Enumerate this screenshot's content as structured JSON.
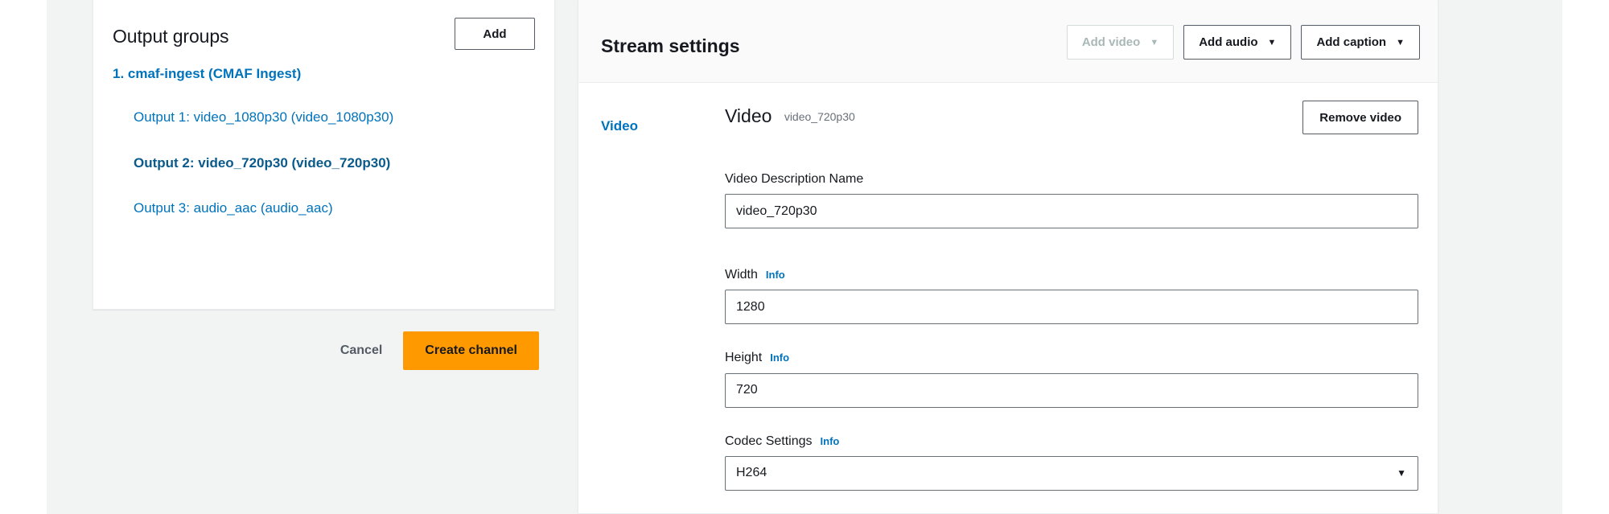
{
  "colors": {
    "link": "#0073bb",
    "primary_button": "#ff9900",
    "page_background": "#f2f3f3",
    "panel_header_background": "#fafafa",
    "border": "#eaeded",
    "input_border": "#687078",
    "muted_text": "#687078",
    "disabled_text": "#aab7b8"
  },
  "output_groups_panel": {
    "title": "Output groups",
    "add_button_label": "Add",
    "groups": [
      {
        "label": "1. cmaf-ingest (CMAF Ingest)",
        "outputs": [
          {
            "label": "Output 1: video_1080p30 (video_1080p30)",
            "selected": false
          },
          {
            "label": "Output 2: video_720p30 (video_720p30)",
            "selected": true
          },
          {
            "label": "Output 3: audio_aac (audio_aac)",
            "selected": false
          }
        ]
      }
    ]
  },
  "form_actions": {
    "cancel_label": "Cancel",
    "submit_label": "Create channel"
  },
  "stream_settings_panel": {
    "title": "Stream settings",
    "actions": [
      {
        "label": "Add video",
        "caret": "▼",
        "disabled": true
      },
      {
        "label": "Add audio",
        "caret": "▼",
        "disabled": false
      },
      {
        "label": "Add caption",
        "caret": "▼",
        "disabled": false
      }
    ],
    "nav": [
      {
        "label": "Video",
        "selected": true
      }
    ],
    "section": {
      "title": "Video",
      "subtitle": "video_720p30",
      "remove_button_label": "Remove video"
    },
    "fields": {
      "video_description_name": {
        "label": "Video Description Name",
        "value": "video_720p30",
        "placeholder": ""
      },
      "width": {
        "label": "Width",
        "info_label": "Info",
        "value": "1280",
        "placeholder": ""
      },
      "height": {
        "label": "Height",
        "info_label": "Info",
        "value": "720",
        "placeholder": ""
      },
      "codec_settings": {
        "label": "Codec Settings",
        "info_label": "Info",
        "value": "H264",
        "caret": "▼"
      }
    }
  }
}
